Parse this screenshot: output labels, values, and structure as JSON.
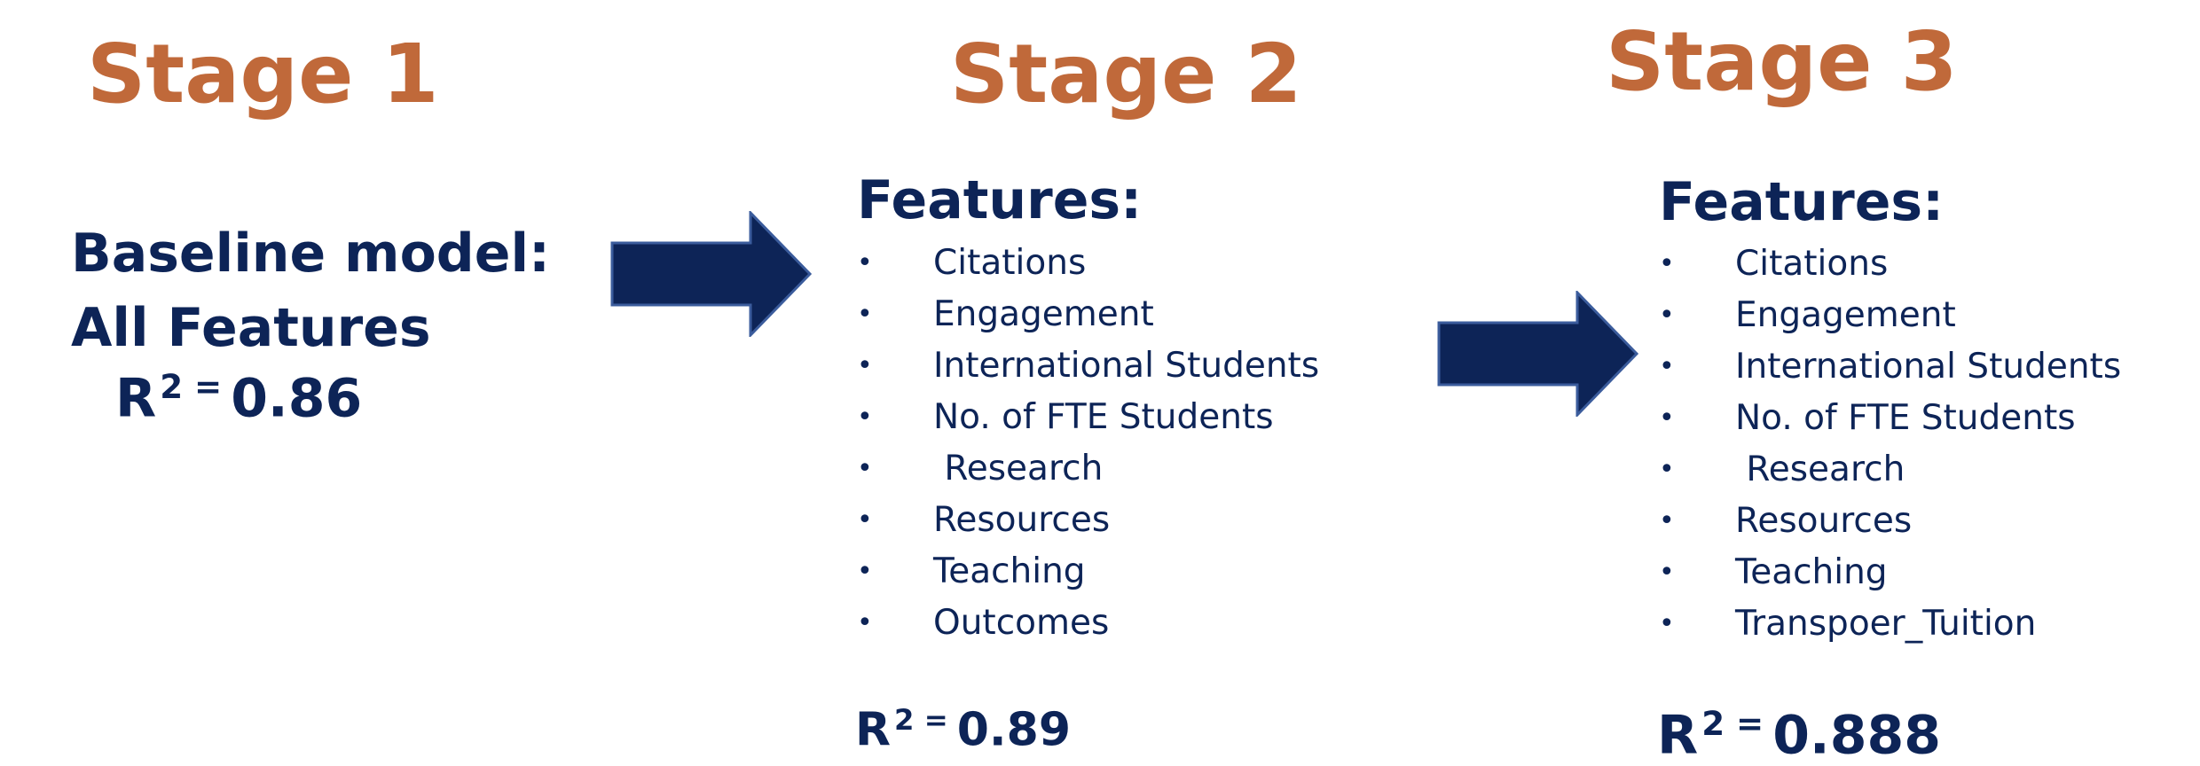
{
  "stages": [
    {
      "title": "Stage 1"
    },
    {
      "title": "Stage 2"
    },
    {
      "title": "Stage 3"
    }
  ],
  "stage1": {
    "line1": "Baseline model:",
    "line2": "All Features",
    "r2_base": "R",
    "r2_sup": "2 =",
    "r2_value": "0.86"
  },
  "stage2": {
    "features_heading": "Features:",
    "features": [
      "Citations",
      "Engagement",
      "International Students",
      "No. of FTE Students",
      " Research",
      "Resources",
      "Teaching",
      "Outcomes"
    ],
    "r2_base": "R",
    "r2_sup": "2 =",
    "r2_value": "0.89"
  },
  "stage3": {
    "features_heading": "Features:",
    "features": [
      "Citations",
      "Engagement",
      "International Students",
      "No. of FTE Students",
      " Research",
      "Resources",
      "Teaching",
      "Transpoer_Tuition"
    ],
    "r2_base": "R",
    "r2_sup": "2 =",
    "r2_value": "0.888"
  },
  "bullet_char": "•",
  "colors": {
    "stage_title": "#C0693A",
    "text": "#0D2457",
    "arrow_fill": "#0D2457",
    "arrow_stroke": "#3B5C9C"
  }
}
